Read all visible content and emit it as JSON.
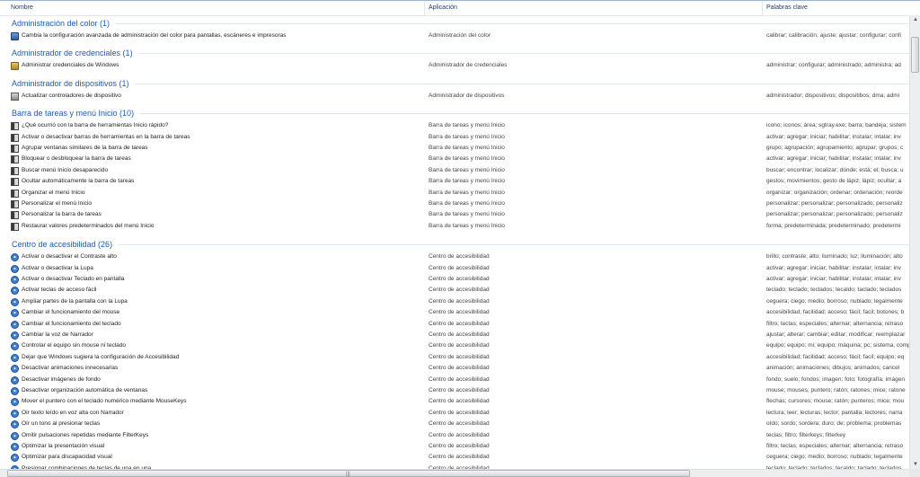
{
  "columns": {
    "name": "Nombre",
    "app": "Aplicación",
    "keywords": "Palabras clave"
  },
  "groups": [
    {
      "title": "Administración del color (1)",
      "icon": "display-color-icon",
      "rows": [
        {
          "name": "Cambia la configuración avanzada de administración del color para pantallas, escáneres e impresoras",
          "app": "Administración del color",
          "kw": "calibrar; calibración; ajuste; ajustar; configurar; confi"
        }
      ]
    },
    {
      "title": "Administrador de credenciales (1)",
      "icon": "credential-safe-icon",
      "rows": [
        {
          "name": "Administrar credenciales de Windows",
          "app": "Administrador de credenciales",
          "kw": "administrar; configurar; administrado; administra; ad"
        }
      ]
    },
    {
      "title": "Administrador de dispositivos (1)",
      "icon": "device-manager-icon",
      "rows": [
        {
          "name": "Actualizar controladores de dispositivo",
          "app": "Administrador de dispositivos",
          "kw": "administrador; dispositivos; dispositibos; dma; admi"
        }
      ]
    },
    {
      "title": "Barra de tareas y menú Inicio (10)",
      "icon": "taskbar-icon",
      "rows": [
        {
          "name": "¿Qué ocurrió con la barra de herramientas Inicio rápido?",
          "app": "Barra de tareas y menú Inicio",
          "kw": "icono; iconos; área; sgtray.exe; barra; bandeja; sistem"
        },
        {
          "name": "Activar o desactivar barras de herramientas en la barra de tareas",
          "app": "Barra de tareas y menú Inicio",
          "kw": "activar; agregar; iniciar; habilitar; instalar; intalar; inv"
        },
        {
          "name": "Agrupar ventanas similares de la barra de tareas",
          "app": "Barra de tareas y menú Inicio",
          "kw": "grupo; agrupación; agrupamiento; agrupar; grupos; c"
        },
        {
          "name": "Bloquear o desbloquear la barra de tareas",
          "app": "Barra de tareas y menú Inicio",
          "kw": "activar; agregar; iniciar; habilitar; instalar; intalar; inv"
        },
        {
          "name": "Buscar menú Inicio desaparecido",
          "app": "Barra de tareas y menú Inicio",
          "kw": "buscar; encontrar; localizar; dónde; está; el; busca; u"
        },
        {
          "name": "Ocultar automáticamente la barra de tareas",
          "app": "Barra de tareas y menú Inicio",
          "kw": "gestos; movimientos; gesto de lápiz; lápiz; ocultar; a"
        },
        {
          "name": "Organizar el menú Inicio",
          "app": "Barra de tareas y menú Inicio",
          "kw": "organizar; organización; ordenar; ordenación; reorde"
        },
        {
          "name": "Personalizar el menú Inicio",
          "app": "Barra de tareas y menú Inicio",
          "kw": "personalizar; personalizar; personalizado; personaliz"
        },
        {
          "name": "Personalizar la barra de tareas",
          "app": "Barra de tareas y menú Inicio",
          "kw": "personalizar; personalizar; personalizado; personaliz"
        },
        {
          "name": "Restaurar valores predeterminados del menú Inicio",
          "app": "Barra de tareas y menú Inicio",
          "kw": "forma; predeterminada; predeterminado; predetermi"
        }
      ]
    },
    {
      "title": "Centro de accesibilidad (26)",
      "icon": "accessibility-icon",
      "rows": [
        {
          "name": "Activar o desactivar el Contraste alto",
          "app": "Centro de accesibilidad",
          "kw": "brillo; contraste; alto; iluminado; luz; iluminación; alto"
        },
        {
          "name": "Activar o desactivar la Lupa",
          "app": "Centro de accesibilidad",
          "kw": "activar; agregar; iniciar; habilitar; instalar; intalar; inv"
        },
        {
          "name": "Activar o desactivar Teclado en pantalla",
          "app": "Centro de accesibilidad",
          "kw": "activar; agregar; iniciar; habilitar; instalar; intalar; inv"
        },
        {
          "name": "Activar teclas de acceso fácil",
          "app": "Centro de accesibilidad",
          "kw": "teclado; teclado; teclados; tecaldo; taclado; teclados"
        },
        {
          "name": "Ampliar partes de la pantalla con la Lupa",
          "app": "Centro de accesibilidad",
          "kw": "ceguera; ciego; medio; borroso; nublado; legalmente"
        },
        {
          "name": "Cambiar el funcionamiento del mouse",
          "app": "Centro de accesibilidad",
          "kw": "accesibilidad; facilidad; acceso; fácil; facil; botones; b"
        },
        {
          "name": "Cambiar el funcionamiento del teclado",
          "app": "Centro de accesibilidad",
          "kw": "filtro; teclas; especiales; alternar; alternancia; retraso"
        },
        {
          "name": "Cambiar la voz de Narrador",
          "app": "Centro de accesibilidad",
          "kw": "ajustar; alterar; cambiar; editar; modificar; reemplazar"
        },
        {
          "name": "Controlar el equipo sin mouse ni teclado",
          "app": "Centro de accesibilidad",
          "kw": "equipo; equipo; mi; equipo; máquina; pc; sistema; comp"
        },
        {
          "name": "Dejar que Windows sugiera la configuración de Accesibilidad",
          "app": "Centro de accesibilidad",
          "kw": "accesibilidad; facilidad; acceso; fácil; facil; equipo; eq"
        },
        {
          "name": "Desactivar animaciones innecesarias",
          "app": "Centro de accesibilidad",
          "kw": "animación; animaciones; dibujos; animados; cancel"
        },
        {
          "name": "Desactivar imágenes de fondo",
          "app": "Centro de accesibilidad",
          "kw": "fondo; suelo; fondos; imagen; foto; fotografía; imágen"
        },
        {
          "name": "Desactivar organización automática de ventanas",
          "app": "Centro de accesibilidad",
          "kw": "mouse; mouses; puntero; ratón; ratones; mice; ratone"
        },
        {
          "name": "Mover el puntero con el teclado numérico mediante MouseKeys",
          "app": "Centro de accesibilidad",
          "kw": "flechas; cursores; mouse; ratón; punteros; mice; mou"
        },
        {
          "name": "Oír texto leído en voz alta con Narrador",
          "app": "Centro de accesibilidad",
          "kw": "lectura; leer; lecturas; lector; pantalla; lectores; narra"
        },
        {
          "name": "Oír un tono al presionar teclas",
          "app": "Centro de accesibilidad",
          "kw": "oído; sordo; sordera; duro; de; problema; problemas"
        },
        {
          "name": "Omitir pulsaciones repetidas mediante FilterKeys",
          "app": "Centro de accesibilidad",
          "kw": "teclas; filtro; filterkeys; filterkey"
        },
        {
          "name": "Optimizar la presentación visual",
          "app": "Centro de accesibilidad",
          "kw": "filtro; teclas; especiales; alternar; alternancia; retraso"
        },
        {
          "name": "Optimizar para discapacidad visual",
          "app": "Centro de accesibilidad",
          "kw": "ceguera; ciego; medio; borroso; nublado; legalmente"
        },
        {
          "name": "Presionar combinaciones de teclas de una en una",
          "app": "Centro de accesibilidad",
          "kw": "teclado; teclado; teclados; tecaldo; taclado; teclados"
        }
      ]
    }
  ]
}
